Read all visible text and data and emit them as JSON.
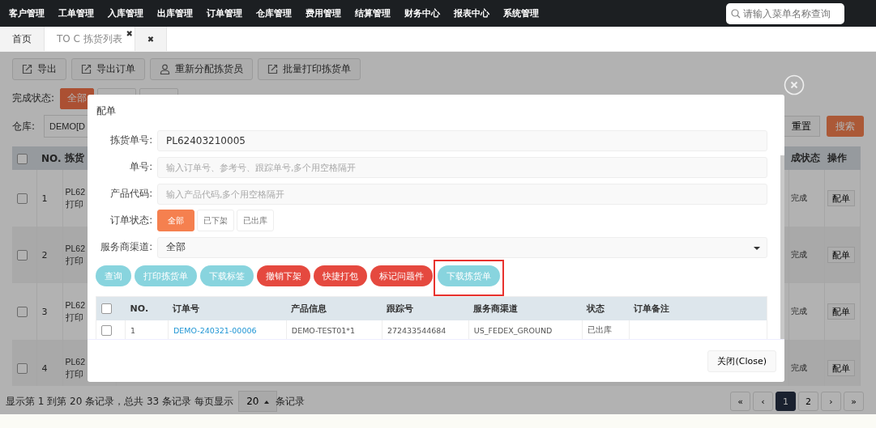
{
  "nav": {
    "items": [
      "客户管理",
      "工单管理",
      "入库管理",
      "出库管理",
      "订单管理",
      "仓库管理",
      "费用管理",
      "结算管理",
      "财务中心",
      "报表中心",
      "系统管理"
    ],
    "search": {
      "placeholder": "请输入菜单名称查询"
    }
  },
  "tabs": [
    {
      "label": "首页",
      "selected": false
    },
    {
      "label": "TO C 拣货列表",
      "selected": true,
      "close": "✖"
    },
    {
      "close": "✖",
      "selected": false
    }
  ],
  "toolbar": [
    {
      "label": "导出",
      "kind": "export"
    },
    {
      "label": "导出订单",
      "kind": "export"
    },
    {
      "label": "重新分配拣货员",
      "kind": "user"
    },
    {
      "label": "批量打印拣货单",
      "kind": "export"
    }
  ],
  "filter": {
    "label": "完成状态:",
    "options": [
      {
        "label": "全部",
        "selected": true
      },
      {
        "selected": false
      },
      {
        "selected": false
      }
    ]
  },
  "warehouse": {
    "label": "仓库:",
    "value": "DEMO[D"
  },
  "reset": "重置",
  "search": "搜索",
  "table": {
    "all_checked": false,
    "columns": [
      "NO.",
      "拣货",
      "成状态",
      "操作"
    ],
    "rows": [
      {
        "checked": false,
        "no": "1",
        "lines": [
          "PL62",
          "打印"
        ],
        "status": "完成",
        "action": "配单"
      },
      {
        "checked": false,
        "no": "2",
        "lines": [
          "PL62",
          "打印"
        ],
        "status": "完成",
        "action": "配单"
      },
      {
        "checked": false,
        "no": "3",
        "lines": [
          "PL62",
          "打印"
        ],
        "status": "完成",
        "action": "配单"
      },
      {
        "checked": false,
        "no": "4",
        "lines": [
          "PL62",
          "打印"
        ],
        "status": "完成",
        "action": "配单"
      }
    ]
  },
  "pagination": {
    "summary": "显示第 1 到第 20 条记录，总共 33 条记录 每页显示",
    "page_size": "20",
    "suffix": "条记录",
    "pages": [
      {
        "label": "«",
        "selected": false
      },
      {
        "label": "‹",
        "selected": false
      },
      {
        "label": "1",
        "selected": true
      },
      {
        "label": "2",
        "selected": false
      },
      {
        "label": "›",
        "selected": false
      },
      {
        "label": "»",
        "selected": false
      }
    ]
  },
  "modal": {
    "title": "配单",
    "fields": [
      {
        "label": "拣货单号:",
        "kind": "text",
        "value": "PL62403210005"
      },
      {
        "label": "单号:",
        "kind": "text",
        "placeholder": "输入订单号、参考号、跟踪单号,多个用空格隔开"
      },
      {
        "label": "产品代码:",
        "kind": "text",
        "placeholder": "输入产品代码,多个用空格隔开"
      },
      {
        "label": "订单状态:",
        "kind": "toggle",
        "options": [
          {
            "label": "全部",
            "selected": true
          },
          {
            "label": "已下架",
            "selected": false
          },
          {
            "label": "已出库",
            "selected": false
          }
        ]
      },
      {
        "label": "服务商渠道:",
        "kind": "select",
        "value": "全部"
      }
    ],
    "actions": [
      {
        "label": "查询",
        "kind": "info",
        "highlighted": false
      },
      {
        "label": "打印拣货单",
        "kind": "info",
        "highlighted": false
      },
      {
        "label": "下载标签",
        "kind": "info",
        "highlighted": false
      },
      {
        "label": "撤销下架",
        "kind": "danger",
        "highlighted": false
      },
      {
        "label": "快捷打包",
        "kind": "danger",
        "highlighted": false
      },
      {
        "label": "标记问题件",
        "kind": "danger",
        "highlighted": false
      },
      {
        "label": "下载拣货单",
        "kind": "info",
        "highlighted": true
      }
    ],
    "table": {
      "all_checked": false,
      "columns": [
        "NO.",
        "订单号",
        "产品信息",
        "跟踪号",
        "服务商渠道",
        "状态",
        "订单备注"
      ],
      "rows": [
        {
          "checked": false,
          "no": "1",
          "order": "DEMO-240321-00006",
          "product": "DEMO-TEST01*1",
          "tracking": "272433544684",
          "channel": "US_FEDEX_GROUND",
          "status": "已出库"
        }
      ]
    },
    "close": "关闭(Close)"
  }
}
